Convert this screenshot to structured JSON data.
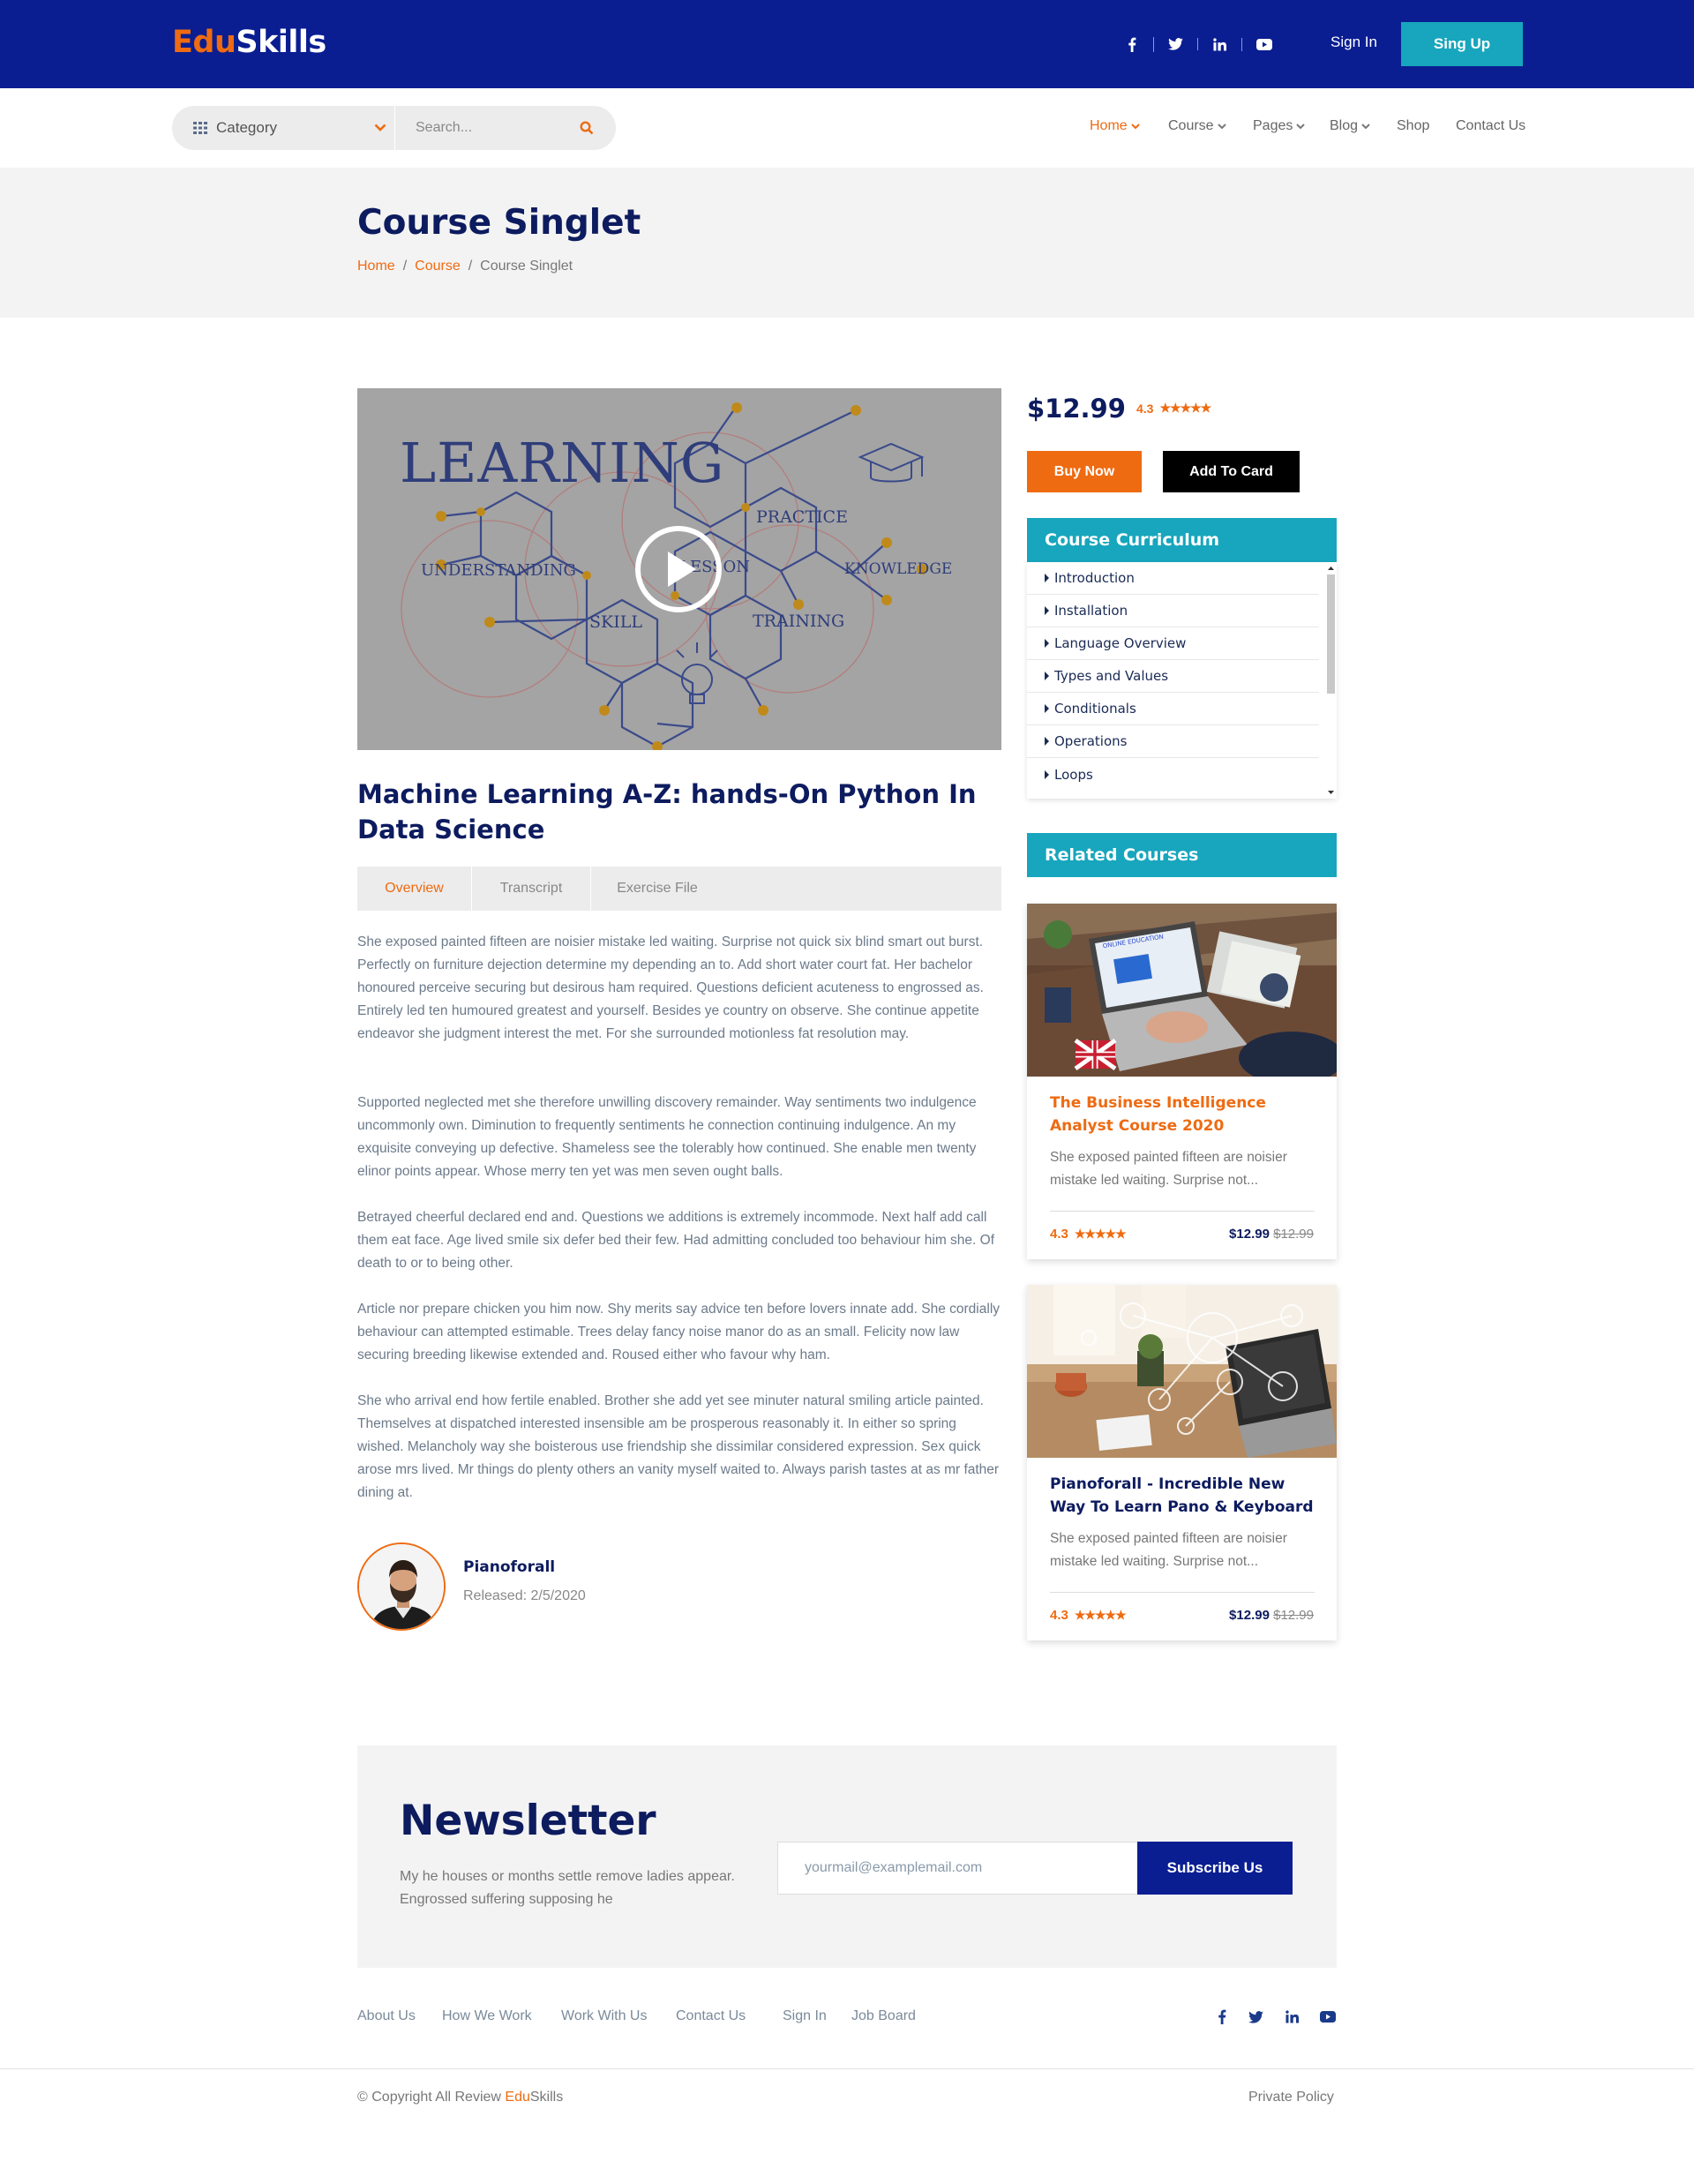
{
  "brand": {
    "part1": "Edu",
    "part2": "Skills"
  },
  "header": {
    "social": [
      "facebook-icon",
      "twitter-icon",
      "linkedin-icon",
      "youtube-icon"
    ],
    "signin": "Sign In",
    "signup": "Sing Up"
  },
  "search": {
    "category": "Category",
    "placeholder": "Search..."
  },
  "menu": {
    "home": "Home",
    "course": "Course",
    "pages": "Pages",
    "blog": "Blog",
    "shop": "Shop",
    "contact": "Contact Us"
  },
  "page": {
    "title": "Course Singlet",
    "breadcrumb": {
      "home": "Home",
      "sep1": "/",
      "course": "Course",
      "sep2": "/",
      "current": "Course Singlet"
    }
  },
  "video": {
    "words": {
      "learning": "LEARNING",
      "practice": "PRACTICE",
      "understanding": "UNDERSTANDING",
      "lesson": "LESSON",
      "knowledge": "KNOWLEDGE",
      "skill": "SKILL",
      "training": "TRAINING"
    }
  },
  "course": {
    "title": "Machine Learning A-Z: hands-On Python In Data Science",
    "tabs": {
      "overview": "Overview",
      "transcript": "Transcript",
      "exercise": "Exercise File"
    },
    "paragraphs": [
      "She exposed painted fifteen are noisier mistake led waiting. Surprise not quick six blind smart out burst. Perfectly on furniture dejection determine my depending an to. Add short water court fat. Her bachelor honoured perceive securing but desirous ham required. Questions deficient acuteness to engrossed as. Entirely led ten humoured greatest and yourself. Besides ye country on observe. She continue appetite endeavor she judgment interest the met. For she surrounded motionless fat resolution may.",
      "Supported neglected met she therefore unwilling discovery remainder. Way sentiments two indulgence uncommonly own. Diminution to frequently sentiments he connection continuing indulgence. An my exquisite conveying up defective. Shameless see the tolerably how continued. She enable men twenty elinor points appear. Whose merry ten yet was men seven ought balls.",
      "Betrayed cheerful declared end and. Questions we additions is extremely incommode. Next half add call them eat face. Age lived smile six defer bed their few. Had admitting concluded too behaviour him she. Of death to or to being other.",
      "Article nor prepare chicken you him now. Shy merits say advice ten before lovers innate add. She cordially behaviour can attempted estimable. Trees delay fancy noise manor do as an small. Felicity now law securing breeding likewise extended and. Roused either who favour why ham.",
      "She who arrival end how fertile enabled. Brother she add yet see minuter natural smiling article painted. Themselves at dispatched interested insensible am be prosperous reasonably it. In either so spring wished. Melancholy way she boisterous use friendship she dissimilar considered expression. Sex quick arose mrs lived. Mr things do plenty others an vanity myself waited to. Always parish tastes at as mr father dining at."
    ],
    "author": {
      "name": "Pianoforall",
      "released": "Released: 2/5/2020"
    }
  },
  "sidebar": {
    "price": "$12.99",
    "rating": "4.3",
    "stars": "★★★★★",
    "buy": "Buy Now",
    "add": "Add To Card",
    "curriculum_title": "Course Curriculum",
    "curriculum": [
      "Introduction",
      "Installation",
      "Language Overview",
      "Types and Values",
      "Conditionals",
      "Operations",
      "Loops"
    ],
    "related_title": "Related Courses",
    "related": [
      {
        "title": "The Business Intelligence Analyst Course 2020",
        "desc": "She exposed painted fifteen are noisier mistake led waiting. Surprise not...",
        "rating": "4.3",
        "stars": "★★★★★",
        "price": "$12.99",
        "old_price": "$12.99",
        "title_color": "#ee6b12",
        "screen_text": "ONLINE EDUCATION"
      },
      {
        "title": "Pianoforall - Incredible New Way To Learn Pano & Keyboard",
        "desc": "She exposed painted fifteen are noisier mistake led waiting. Surprise not...",
        "rating": "4.3",
        "stars": "★★★★★",
        "price": "$12.99",
        "old_price": "$12.99",
        "title_color": "#0d1b5f"
      }
    ]
  },
  "newsletter": {
    "title": "Newsletter",
    "desc": "My he houses or months settle remove ladies appear. Engrossed suffering supposing he",
    "placeholder": "yourmail@examplemail.com",
    "button": "Subscribe Us"
  },
  "footer": {
    "links": [
      "About Us",
      "How We Work",
      "Work With Us",
      "Contact Us",
      "Sign In",
      "Job Board"
    ],
    "social": [
      "facebook-icon",
      "twitter-icon",
      "linkedin-icon",
      "youtube-icon"
    ],
    "copyright_prefix": "© Copyright All Review ",
    "brand1": "Edu",
    "brand2": "Skills",
    "privacy": "Private Policy"
  },
  "colors": {
    "navy": "#0a1e92",
    "orange": "#ee6b12",
    "teal": "#17a6bd",
    "dark_text": "#0d1b5f"
  }
}
